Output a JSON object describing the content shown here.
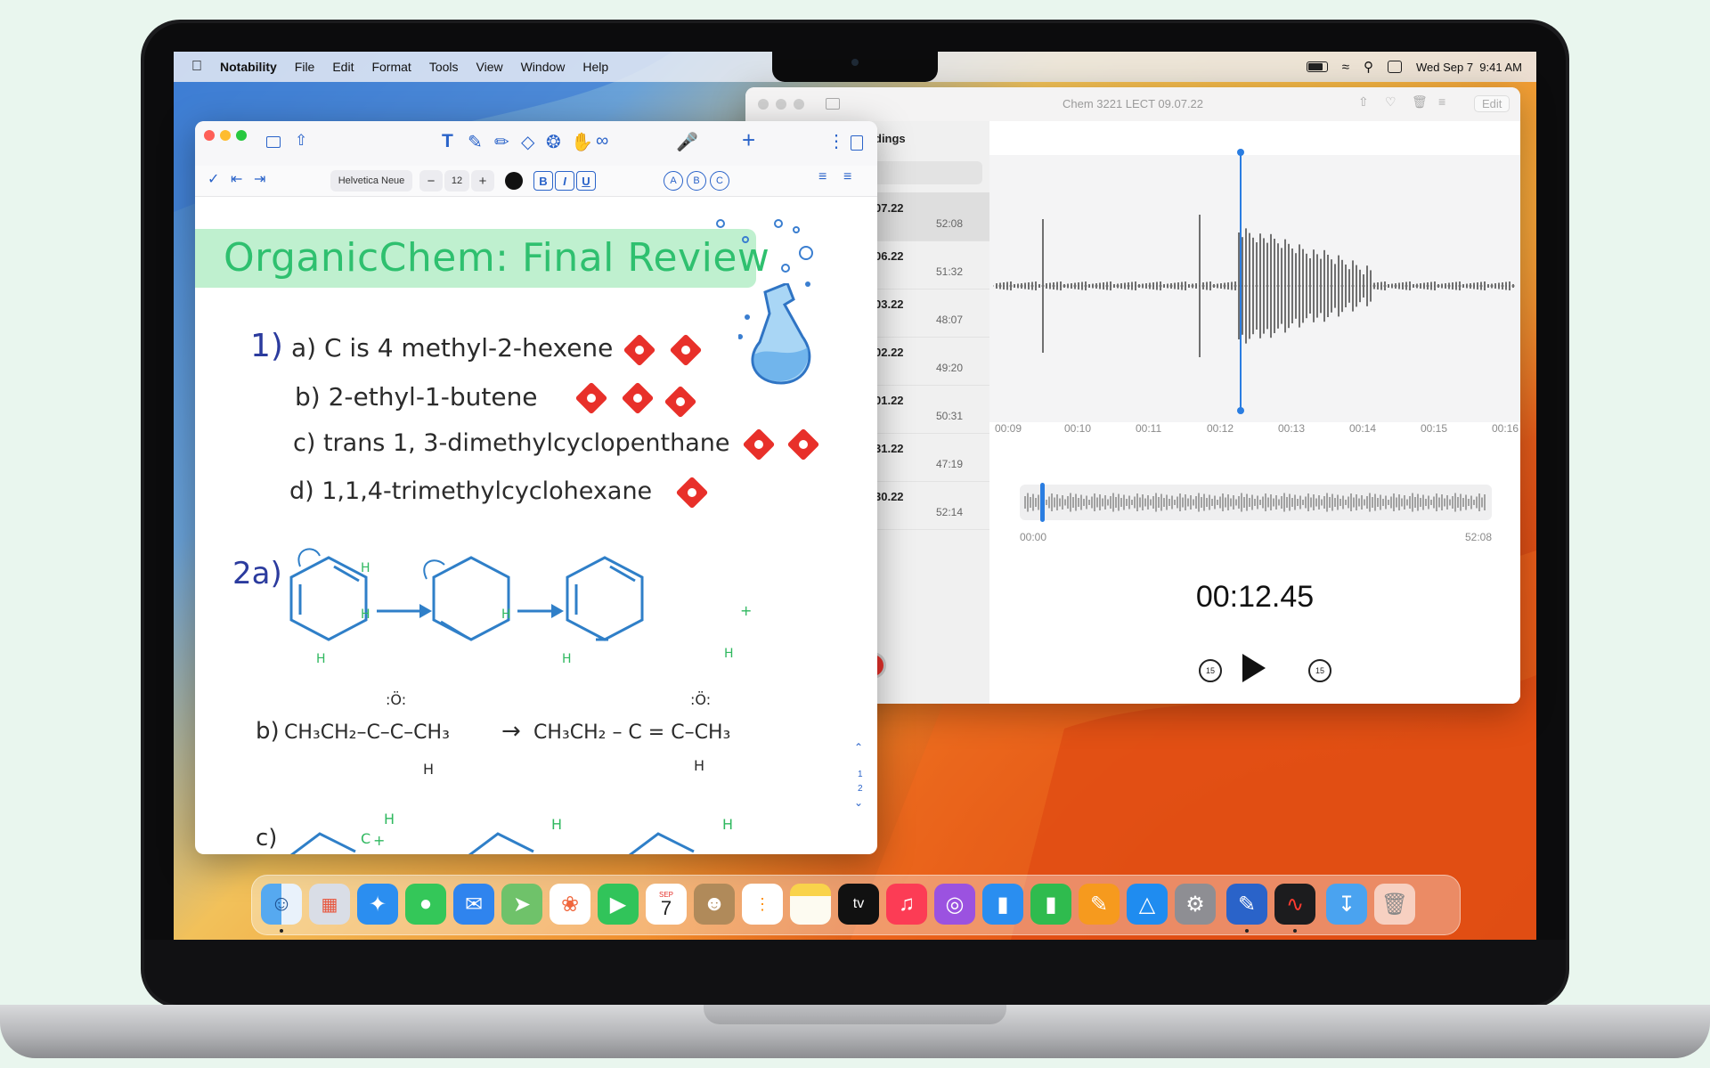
{
  "menubar": {
    "app_name": "Notability",
    "menus": [
      "File",
      "Edit",
      "Format",
      "Tools",
      "View",
      "Window",
      "Help"
    ],
    "clock": "Wed Sep 7  9:41 AM"
  },
  "notability": {
    "font_name": "Helvetica Neue",
    "font_size": "12",
    "format_bold": "B",
    "format_italic": "I",
    "format_underline": "U",
    "circle_buttons": [
      "A",
      "B",
      "C"
    ],
    "title": "OrganicChem: Final Review",
    "q1_number": "1)",
    "q1_items": [
      "a) C is 4 methyl-2-hexene",
      "b) 2-ethyl-1-butene",
      "c) trans 1, 3-dimethylcyclopenthane",
      "d) 1,1,4-trimethylcyclohexane"
    ],
    "q2_number": "2a)",
    "q2b_label": "b)",
    "q2b_left": "CH₃CH₂–C–C–CH₃",
    "q2b_arrow": "→",
    "q2b_right": "CH₃CH₂ – C = C–CH₃",
    "q2c_label": "c)",
    "h_label": "H",
    "h_plus_label": "H",
    "plus_sign": "+",
    "carbon_label": "C",
    "carbocation_label": "+",
    "oxygen_label": ":Ö:",
    "page_numbers": [
      "1",
      "2"
    ]
  },
  "voicememo": {
    "window_title": "Chem 3221 LECT 09.07.22",
    "edit_label": "Edit",
    "sidebar_header": "dings",
    "recordings": [
      {
        "name": "07.22",
        "duration": "52:08"
      },
      {
        "name": "06.22",
        "duration": "51:32"
      },
      {
        "name": "03.22",
        "duration": "48:07"
      },
      {
        "name": "02.22",
        "duration": "49:20"
      },
      {
        "name": "01.22",
        "duration": "50:31"
      },
      {
        "name": "31.22",
        "duration": "47:19"
      },
      {
        "name": "30.22",
        "duration": "52:14"
      }
    ],
    "timeline_ticks": [
      "00:09",
      "00:10",
      "00:11",
      "00:12",
      "00:13",
      "00:14",
      "00:15",
      "00:16"
    ],
    "overview_start": "00:00",
    "overview_end": "52:08",
    "current_time": "00:12.45",
    "skip_back": "15",
    "skip_forward": "15"
  },
  "dock": {
    "icons": [
      "finder-icon",
      "launchpad-icon",
      "safari-icon",
      "messages-icon",
      "mail-icon",
      "maps-icon",
      "photos-icon",
      "facetime-icon",
      "calendar-icon",
      "contacts-icon",
      "reminders-icon",
      "notes-icon",
      "tv-icon",
      "music-icon",
      "podcasts-icon",
      "keynote-icon",
      "numbers-icon",
      "pages-icon",
      "app-store-icon",
      "system-settings-icon",
      "notability-icon",
      "voice-memos-icon",
      "downloads-icon",
      "trash-icon"
    ],
    "calendar_month": "SEP",
    "calendar_day": "7",
    "tv_label": "tv"
  }
}
